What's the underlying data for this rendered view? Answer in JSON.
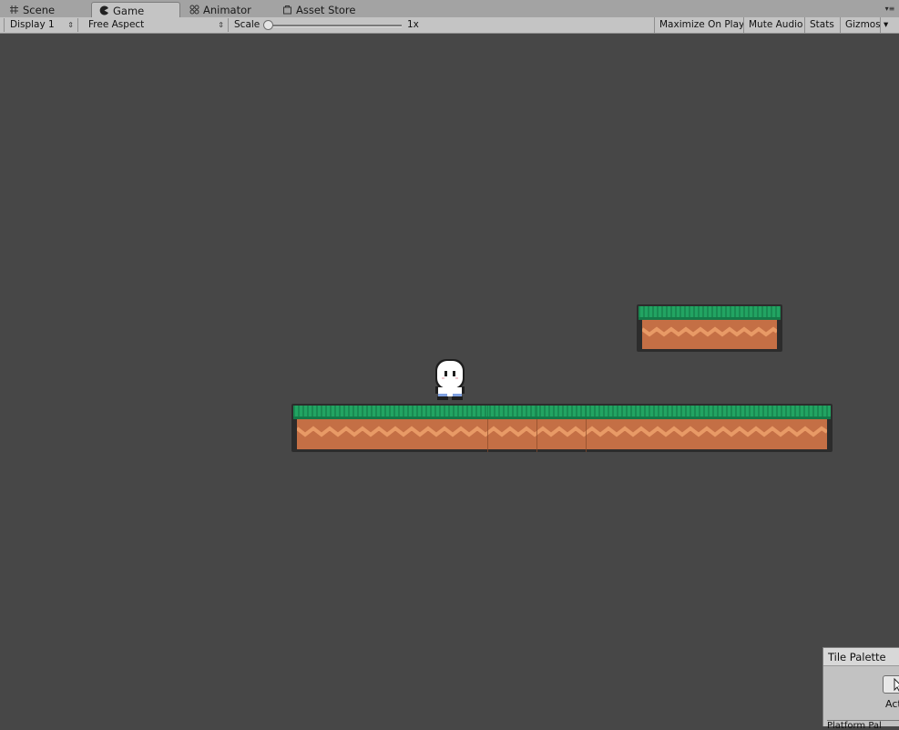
{
  "tabs": [
    {
      "label": "Scene",
      "icon": "hash-icon"
    },
    {
      "label": "Game",
      "icon": "pacman-icon",
      "active": true
    },
    {
      "label": "Animator",
      "icon": "animator-icon"
    },
    {
      "label": "Asset Store",
      "icon": "store-icon"
    }
  ],
  "tab_menu_glyph": "▾≡",
  "toolbar": {
    "display": "Display 1",
    "aspect": "Free Aspect",
    "scale_label": "Scale",
    "scale_value": "1x",
    "buttons": [
      "Maximize On Play",
      "Mute Audio",
      "Stats",
      "Gizmos"
    ],
    "gizmos_arrow": "▾"
  },
  "tile_palette": {
    "title": "Tile Palette",
    "label_partial": "Act",
    "bottom_partial": "Platform Pal"
  },
  "colors": {
    "viewport_bg": "#474747",
    "grass": "#1f9a5c",
    "dirt": "#c46f45",
    "dirt_wave": "#e89a66"
  }
}
